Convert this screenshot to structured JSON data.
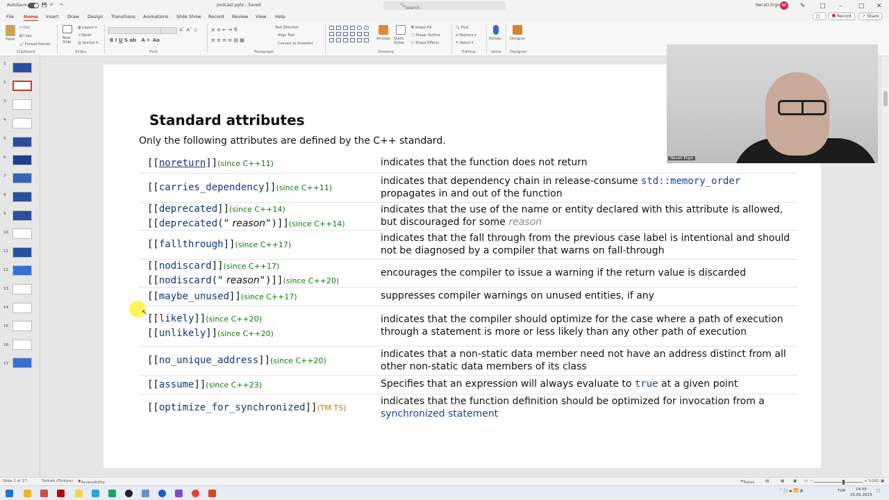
{
  "window": {
    "autosave_label": "AutoSave",
    "autosave_state": "Off",
    "file_name": "podcast.pptx - Saved",
    "search_placeholder": "Search",
    "user_name": "Necati Ergin",
    "user_initials": "NE"
  },
  "tabs": [
    "File",
    "Home",
    "Insert",
    "Draw",
    "Design",
    "Transitions",
    "Animations",
    "Slide Show",
    "Record",
    "Review",
    "View",
    "Help"
  ],
  "active_tab": "Home",
  "ribbon_actions": {
    "record": "Record",
    "share": "Share"
  },
  "ribbon": {
    "clipboard": {
      "paste": "Paste",
      "cut": "Cut",
      "copy": "Copy",
      "format_painter": "Format Painter",
      "label": "Clipboard"
    },
    "slides": {
      "new_slide": "New Slide",
      "layout": "Layout",
      "reset": "Reset",
      "section": "Section",
      "label": "Slides"
    },
    "font": {
      "label": "Font"
    },
    "paragraph": {
      "text_direction": "Text Direction",
      "align_text": "Align Text",
      "convert_smartart": "Convert to SmartArt",
      "label": "Paragraph"
    },
    "drawing": {
      "arrange": "Arrange",
      "quick_styles": "Quick Styles",
      "shape_fill": "Shape Fill",
      "shape_outline": "Shape Outline",
      "shape_effects": "Shape Effects",
      "label": "Drawing"
    },
    "editing": {
      "find": "Find",
      "replace": "Replace",
      "select": "Select",
      "label": "Editing"
    },
    "voice": {
      "dictate": "Dictate",
      "label": "Voice"
    },
    "designer": {
      "designer": "Designer",
      "label": "Designer"
    }
  },
  "thumbnails": [
    "1",
    "2",
    "3",
    "4",
    "5",
    "6",
    "7",
    "8",
    "9",
    "10",
    "11",
    "12",
    "13",
    "14",
    "15",
    "16",
    "17"
  ],
  "slide": {
    "title": "Standard attributes",
    "intro": "Only the following attributes are defined by the C++ standard.",
    "rows": [
      {
        "lines": [
          {
            "open": "[[",
            "name": "noreturn",
            "close": "]]",
            "since": "(since C++11)"
          }
        ],
        "desc": [
          {
            "t": "indicates that the function does not return",
            "s": "plain"
          }
        ]
      },
      {
        "lines": [
          {
            "open": "[[",
            "name": "carries_dependency",
            "close": "]]",
            "since": "(since C++11)"
          }
        ],
        "desc": [
          {
            "t": "indicates that dependency chain in release-consume ",
            "s": "plain"
          },
          {
            "t": "std::memory_order",
            "s": "code"
          },
          {
            "t": " propagates in and out of the function",
            "s": "plain"
          }
        ]
      },
      {
        "lines": [
          {
            "open": "[[",
            "name": "deprecated",
            "close": "]]",
            "since": "(since C++14)"
          },
          {
            "open": "[[",
            "name": "deprecated",
            "args_open": "(\"",
            "arg": " reason",
            "args_close": "\")",
            "close": "]]",
            "since": "(since C++14)"
          }
        ],
        "desc": [
          {
            "t": "indicates that the use of the name or entity declared with this attribute is allowed, but discouraged for some ",
            "s": "plain"
          },
          {
            "t": "reason",
            "s": "gray"
          }
        ]
      },
      {
        "lines": [
          {
            "open": "[[",
            "name": "fallthrough",
            "close": "]]",
            "since": "(since C++17)"
          }
        ],
        "desc": [
          {
            "t": "indicates that the fall through from the previous case label is intentional and should not be diagnosed by a compiler that warns on fall-through",
            "s": "plain"
          }
        ]
      },
      {
        "lines": [
          {
            "open": "[[",
            "name": "nodiscard",
            "close": "]]",
            "since": "(since C++17)"
          },
          {
            "open": "[[",
            "name": "nodiscard",
            "args_open": "(\"",
            "arg": " reason",
            "args_close": "\")",
            "close": "]]",
            "since": "(since C++20)"
          }
        ],
        "desc": [
          {
            "t": "encourages the compiler to issue a warning if the return value is discarded",
            "s": "plain"
          }
        ]
      },
      {
        "lines": [
          {
            "open": "[[",
            "name": "maybe_unused",
            "close": "]]",
            "since": "(since C++17)"
          }
        ],
        "desc": [
          {
            "t": "suppresses compiler warnings on unused entities, if any",
            "s": "plain"
          }
        ]
      },
      {
        "lines": [
          {
            "open": "[[",
            "name": "likely",
            "close": "]]",
            "since": "(since C++20)"
          },
          {
            "open": "[[",
            "name": "unlikely",
            "close": "]]",
            "since": "(since C++20)"
          }
        ],
        "desc": [
          {
            "t": "indicates that the compiler should optimize for the case where a path of execution through a statement is more or less likely than any other path of execution",
            "s": "plain"
          }
        ]
      },
      {
        "lines": [
          {
            "open": "[[",
            "name": "no_unique_address",
            "close": "]]",
            "since": "(since C++20)"
          }
        ],
        "desc": [
          {
            "t": "indicates that a non-static data member need not have an address distinct from all other non-static data members of its class",
            "s": "plain"
          }
        ]
      },
      {
        "lines": [
          {
            "open": "[[",
            "name": "assume",
            "close": "]]",
            "since": "(since C++23)"
          }
        ],
        "desc": [
          {
            "t": "Specifies that an expression will always evaluate to ",
            "s": "plain"
          },
          {
            "t": "true",
            "s": "code"
          },
          {
            "t": " at a given point",
            "s": "plain"
          }
        ]
      },
      {
        "lines": [
          {
            "open": "[[",
            "name": "optimize_for_synchronized",
            "close": "]]",
            "since": "(TM TS)",
            "ts": true
          }
        ],
        "desc": [
          {
            "t": "indicates that the function definition should be optimized for invocation from a ",
            "s": "plain"
          },
          {
            "t": "synchronized statement",
            "s": "link"
          }
        ]
      }
    ]
  },
  "webcam": {
    "name": "Necati Ergin"
  },
  "statusbar": {
    "slide_of": "Slide 2 of 17",
    "language": "Turkish (Türkiye)",
    "accessibility": "Accessibility: Investigate",
    "notes": "Notes",
    "zoom": "%162"
  },
  "taskbar": {
    "lang": "TUR",
    "time": "14:05",
    "date": "20.05.2023"
  },
  "colors": {
    "accent": "#c43e1c",
    "code": "#10357e",
    "since": "#0a7a0a",
    "ts": "#d86a00"
  }
}
